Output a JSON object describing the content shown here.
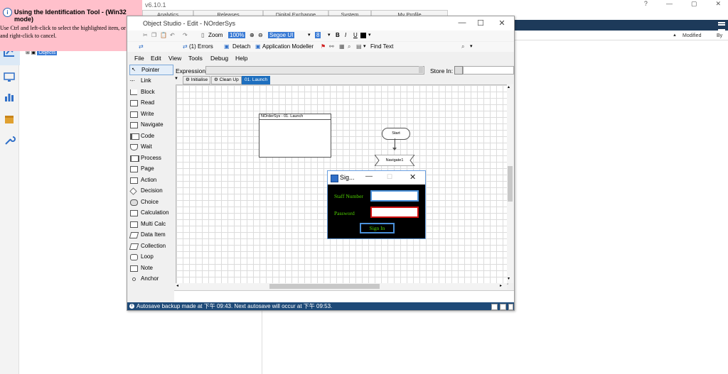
{
  "background": {
    "version": "v6.10.1",
    "tabs": [
      "Analytics",
      "Releases",
      "Digital Exchange",
      "System",
      "My Profile"
    ],
    "window_controls": [
      "?",
      "—",
      "▢",
      "✕"
    ],
    "table_headers": {
      "modified": "Modified",
      "by": "By"
    },
    "tree_objects_label": "Objects"
  },
  "tooltip": {
    "title": "Using the Identification Tool - (Win32 mode)",
    "body": "Use Ctrl and left-click to select the highlighted item, or Ctrl and right-click to cancel."
  },
  "object_studio": {
    "title": "Object Studio  - Edit - NOrderSys",
    "toolbar1": {
      "zoom_label": "Zoom",
      "zoom_value": "100%",
      "font_value": "Segoe UI",
      "font_size": "8",
      "bold": "B",
      "italic": "I",
      "underline": "U"
    },
    "toolbar2": {
      "errors": "(1) Errors",
      "detach": "Detach",
      "app_modeller": "Application Modeller",
      "find_text": "Find Text"
    },
    "menu": [
      "File",
      "Edit",
      "View",
      "Tools",
      "Debug",
      "Help"
    ],
    "palette": [
      {
        "label": "Pointer"
      },
      {
        "label": "Link"
      },
      {
        "label": "Block"
      },
      {
        "label": "Read"
      },
      {
        "label": "Write"
      },
      {
        "label": "Navigate"
      },
      {
        "label": "Code"
      },
      {
        "label": "Wait"
      },
      {
        "label": "Process"
      },
      {
        "label": "Page"
      },
      {
        "label": "Action"
      },
      {
        "label": "Decision"
      },
      {
        "label": "Choice"
      },
      {
        "label": "Calculation"
      },
      {
        "label": "Multi Calc"
      },
      {
        "label": "Data Item"
      },
      {
        "label": "Collection"
      },
      {
        "label": "Loop"
      },
      {
        "label": "Note"
      },
      {
        "label": "Anchor"
      }
    ],
    "expression_label": "Expression:",
    "store_in_label": "Store In:",
    "page_tabs": [
      "Initialise",
      "Clean Up",
      "01. Launch"
    ],
    "canvas": {
      "block_title": "NOrderSys - 01. Launch",
      "start_label": "Start",
      "navigate_label": "Navigate1"
    },
    "status": "Autosave backup made at 下午 09:43. Next autosave will occur at 下午 09:53."
  },
  "signin": {
    "caption": "Sig...",
    "staff_label": "Staff Number",
    "password_label": "Password",
    "button_label": "Sign In"
  }
}
